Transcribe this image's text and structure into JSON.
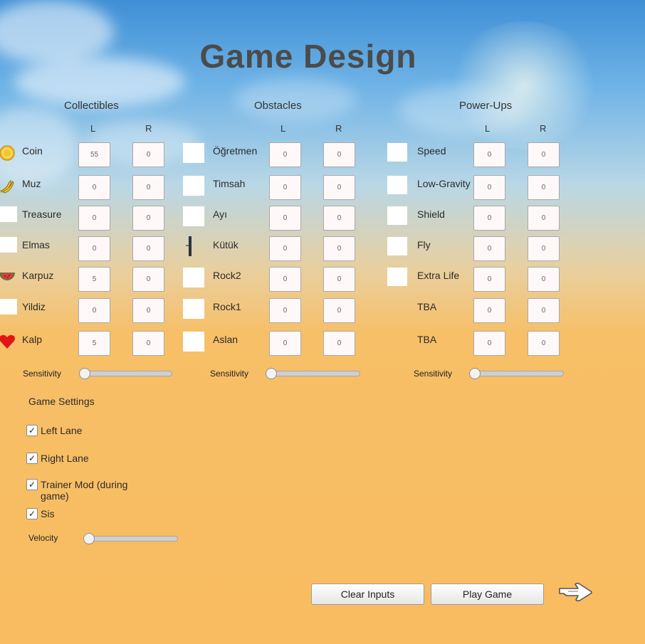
{
  "title": "Game Design",
  "columns": {
    "left": "L",
    "right": "R"
  },
  "collectibles": {
    "title": "Collectibles",
    "items": [
      {
        "label": "Coin",
        "icon": "coin-icon",
        "l": "55",
        "r": "0"
      },
      {
        "label": "Muz",
        "icon": "banana-icon",
        "l": "0",
        "r": "0"
      },
      {
        "label": "Treasure",
        "icon": "",
        "l": "0",
        "r": "0"
      },
      {
        "label": "Elmas",
        "icon": "",
        "l": "0",
        "r": "0"
      },
      {
        "label": "Karpuz",
        "icon": "watermelon-icon",
        "l": "5",
        "r": "0"
      },
      {
        "label": "Yildiz",
        "icon": "",
        "l": "0",
        "r": "0"
      },
      {
        "label": "Kalp",
        "icon": "heart-icon",
        "l": "5",
        "r": "0"
      }
    ],
    "sensitivity_label": "Sensitivity",
    "sensitivity": 0
  },
  "obstacles": {
    "title": "Obstacles",
    "items": [
      {
        "label": "Öğretmen",
        "icon": "",
        "l": "0",
        "r": "0"
      },
      {
        "label": "Timsah",
        "icon": "",
        "l": "0",
        "r": "0"
      },
      {
        "label": "Ayı",
        "icon": "",
        "l": "0",
        "r": "0"
      },
      {
        "label": "Kütük",
        "icon": "log-icon",
        "l": "0",
        "r": "0"
      },
      {
        "label": "Rock2",
        "icon": "",
        "l": "0",
        "r": "0"
      },
      {
        "label": "Rock1",
        "icon": "",
        "l": "0",
        "r": "0"
      },
      {
        "label": "Aslan",
        "icon": "",
        "l": "0",
        "r": "0"
      }
    ],
    "sensitivity_label": "Sensitivity",
    "sensitivity": 0
  },
  "powerups": {
    "title": "Power-Ups",
    "items": [
      {
        "label": "Speed",
        "icon": "",
        "l": "0",
        "r": "0"
      },
      {
        "label": "Low-Gravity",
        "icon": "",
        "l": "0",
        "r": "0"
      },
      {
        "label": "Shield",
        "icon": "",
        "l": "0",
        "r": "0"
      },
      {
        "label": "Fly",
        "icon": "",
        "l": "0",
        "r": "0"
      },
      {
        "label": "Extra Life",
        "icon": "",
        "l": "0",
        "r": "0"
      },
      {
        "label": "TBA",
        "icon": "none",
        "l": "0",
        "r": "0"
      },
      {
        "label": "TBA",
        "icon": "none",
        "l": "0",
        "r": "0"
      }
    ],
    "sensitivity_label": "Sensitivity",
    "sensitivity": 0
  },
  "game_settings": {
    "title": "Game Settings",
    "options": [
      {
        "label": "Left Lane",
        "checked": true
      },
      {
        "label": "Right Lane",
        "checked": true
      },
      {
        "label": "Trainer Mod (during game)",
        "checked": true
      },
      {
        "label": "Sis",
        "checked": true
      }
    ],
    "velocity_label": "Velocity",
    "velocity": 0
  },
  "buttons": {
    "clear": "Clear Inputs",
    "play": "Play Game"
  },
  "next_icon": "pointing-hand-arrow-icon"
}
